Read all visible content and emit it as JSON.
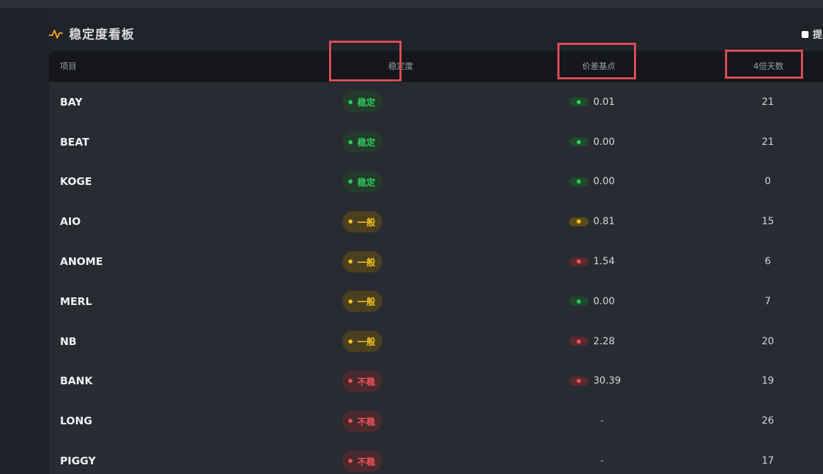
{
  "board": {
    "title": "稳定度看板",
    "hide_label": "提"
  },
  "table": {
    "columns": [
      "项目",
      "稳定度",
      "价差基点",
      "4倍天数"
    ],
    "rows": [
      {
        "name": "BAY",
        "stability": "稳定",
        "level": "green",
        "spread": "0.01",
        "spread_level": "green",
        "days": "21"
      },
      {
        "name": "BEAT",
        "stability": "稳定",
        "level": "green",
        "spread": "0.00",
        "spread_level": "green",
        "days": "21"
      },
      {
        "name": "KOGE",
        "stability": "稳定",
        "level": "green",
        "spread": "0.00",
        "spread_level": "green",
        "days": "0"
      },
      {
        "name": "AIO",
        "stability": "一般",
        "level": "yellow",
        "spread": "0.81",
        "spread_level": "yellow",
        "days": "15"
      },
      {
        "name": "ANOME",
        "stability": "一般",
        "level": "yellow",
        "spread": "1.54",
        "spread_level": "red",
        "days": "6"
      },
      {
        "name": "MERL",
        "stability": "一般",
        "level": "yellow",
        "spread": "0.00",
        "spread_level": "green",
        "days": "7"
      },
      {
        "name": "NB",
        "stability": "一般",
        "level": "yellow",
        "spread": "2.28",
        "spread_level": "red",
        "days": "20"
      },
      {
        "name": "BANK",
        "stability": "不稳",
        "level": "red",
        "spread": "30.39",
        "spread_level": "red",
        "days": "19"
      },
      {
        "name": "LONG",
        "stability": "不稳",
        "level": "red",
        "spread": "-",
        "spread_level": "none",
        "days": "26"
      },
      {
        "name": "PIGGY",
        "stability": "不稳",
        "level": "red",
        "spread": "-",
        "spread_level": "none",
        "days": "17"
      }
    ]
  },
  "colors": {
    "stable": "#2fca5c",
    "normal": "#f3c01a",
    "unstable": "#f0505c",
    "highlight": "#e14d58"
  },
  "icons": {
    "header": "pulse-icon"
  }
}
